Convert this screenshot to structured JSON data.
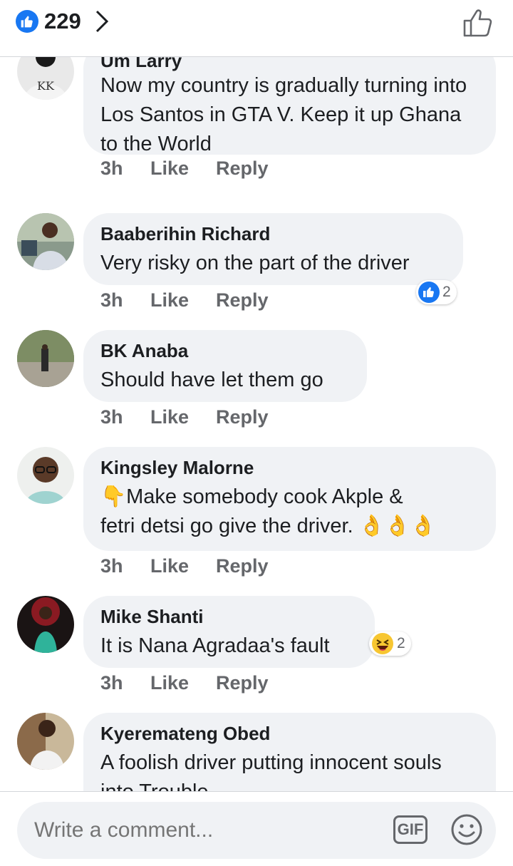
{
  "header": {
    "like_count": "229"
  },
  "comments": [
    {
      "author": "Um Larry",
      "text": "Now my country is gradually turning into Los Santos in GTA V. Keep it up Ghana to the World",
      "time": "3h",
      "like_label": "Like",
      "reply_label": "Reply"
    },
    {
      "author": "Baaberihin Richard",
      "text": "Very risky on the part of the driver",
      "time": "3h",
      "like_label": "Like",
      "reply_label": "Reply",
      "reaction": {
        "icon": "like-icon",
        "count": "2"
      }
    },
    {
      "author": "BK Anaba",
      "text": "Should have let them go",
      "time": "3h",
      "like_label": "Like",
      "reply_label": "Reply"
    },
    {
      "author": "Kingsley Malorne",
      "text_line1": "👇Make somebody cook Akple &",
      "text_line2": "fetri detsi  go give the driver. 👌👌👌",
      "time": "3h",
      "like_label": "Like",
      "reply_label": "Reply"
    },
    {
      "author": "Mike Shanti",
      "text": "It is Nana Agradaa's fault",
      "time": "3h",
      "like_label": "Like",
      "reply_label": "Reply",
      "reaction": {
        "icon": "haha-icon",
        "count": "2"
      }
    },
    {
      "author": "Kyeremateng Obed",
      "text": "A foolish driver putting innocent souls into Trouble"
    }
  ],
  "footer": {
    "placeholder": "Write a comment...",
    "gif_label": "GIF"
  },
  "colors": {
    "facebook_blue": "#1877f2",
    "bubble_bg": "#f0f2f5",
    "muted_text": "#65676b"
  }
}
